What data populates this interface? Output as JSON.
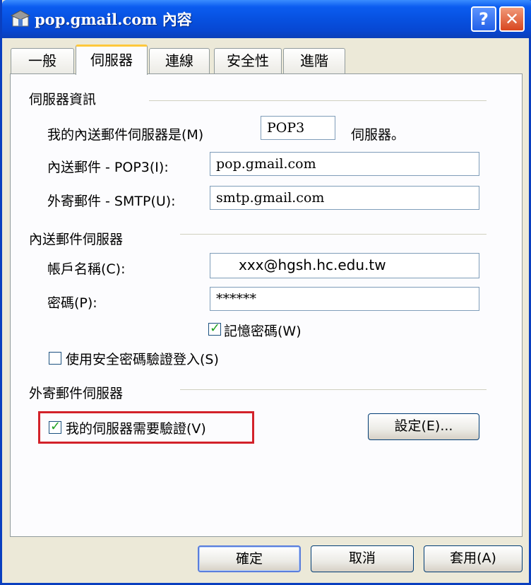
{
  "window": {
    "title": "pop.gmail.com 內容",
    "icon": "mail-account-icon"
  },
  "tabs": [
    {
      "label": "一般"
    },
    {
      "label": "伺服器"
    },
    {
      "label": "連線"
    },
    {
      "label": "安全性"
    },
    {
      "label": "進階"
    }
  ],
  "server_info": {
    "group_title": "伺服器資訊",
    "incoming_type_label": "我的內送郵件伺服器是(M)",
    "incoming_type_value": "POP3",
    "incoming_type_suffix": "伺服器。",
    "pop3_label": "內送郵件 - POP3(I):",
    "pop3_value": "pop.gmail.com",
    "smtp_label": "外寄郵件 - SMTP(U):",
    "smtp_value": "smtp.gmail.com"
  },
  "incoming_server": {
    "group_title": "內送郵件伺服器",
    "account_label": "帳戶名稱(C):",
    "account_value": "xxx@hgsh.hc.edu.tw",
    "password_label": "密碼(P):",
    "password_value": "******",
    "remember_password_label": "記憶密碼(W)",
    "remember_password_checked": true,
    "spa_label": "使用安全密碼驗證登入(S)",
    "spa_checked": false
  },
  "outgoing_server": {
    "group_title": "外寄郵件伺服器",
    "requires_auth_label": "我的伺服器需要驗證(V)",
    "requires_auth_checked": true,
    "settings_button": "設定(E)..."
  },
  "buttons": {
    "ok": "確定",
    "cancel": "取消",
    "apply": "套用(A)"
  },
  "colors": {
    "titlebar": "#0751e0",
    "highlight": "#d3222a",
    "check": "#21a121",
    "active_tab_accent": "#ffc83c"
  }
}
